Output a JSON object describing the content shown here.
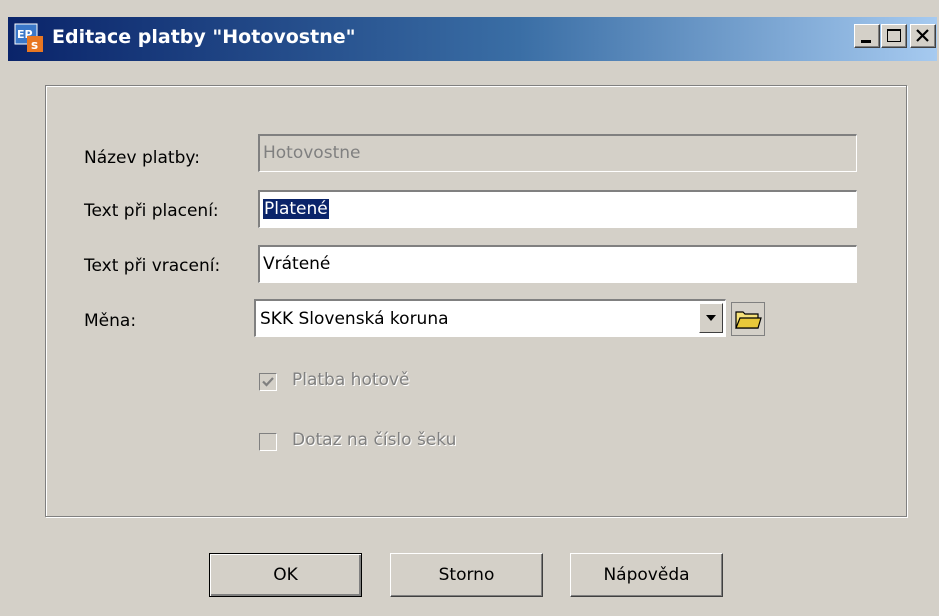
{
  "window": {
    "title": "Editace platby \"Hotovostne\"",
    "title_bar_color": "#0a246a",
    "face_color": "#d4d0c8"
  },
  "form": {
    "name": {
      "label": "Název platby:",
      "value": "Hotovostne",
      "enabled": false
    },
    "pay_text": {
      "label": "Text při placení:",
      "value": "Platené",
      "selected": true
    },
    "refund_text": {
      "label": "Text při vracení:",
      "value": "Vrátené"
    },
    "currency": {
      "label": "Měna:",
      "value": "SKK Slovenská koruna"
    },
    "cash_payment": {
      "label": "Platba hotově",
      "checked": true,
      "enabled": false
    },
    "cheque_query": {
      "label": "Dotaz na číslo šeku",
      "checked": false,
      "enabled": false
    }
  },
  "buttons": {
    "ok": "OK",
    "cancel": "Storno",
    "help": "Nápověda"
  },
  "icons": {
    "app": "app-icon",
    "minimize": "minimize-icon",
    "maximize": "maximize-icon",
    "close": "close-icon",
    "dropdown": "chevron-down-icon",
    "browse": "folder-icon",
    "check": "checkmark-icon"
  }
}
